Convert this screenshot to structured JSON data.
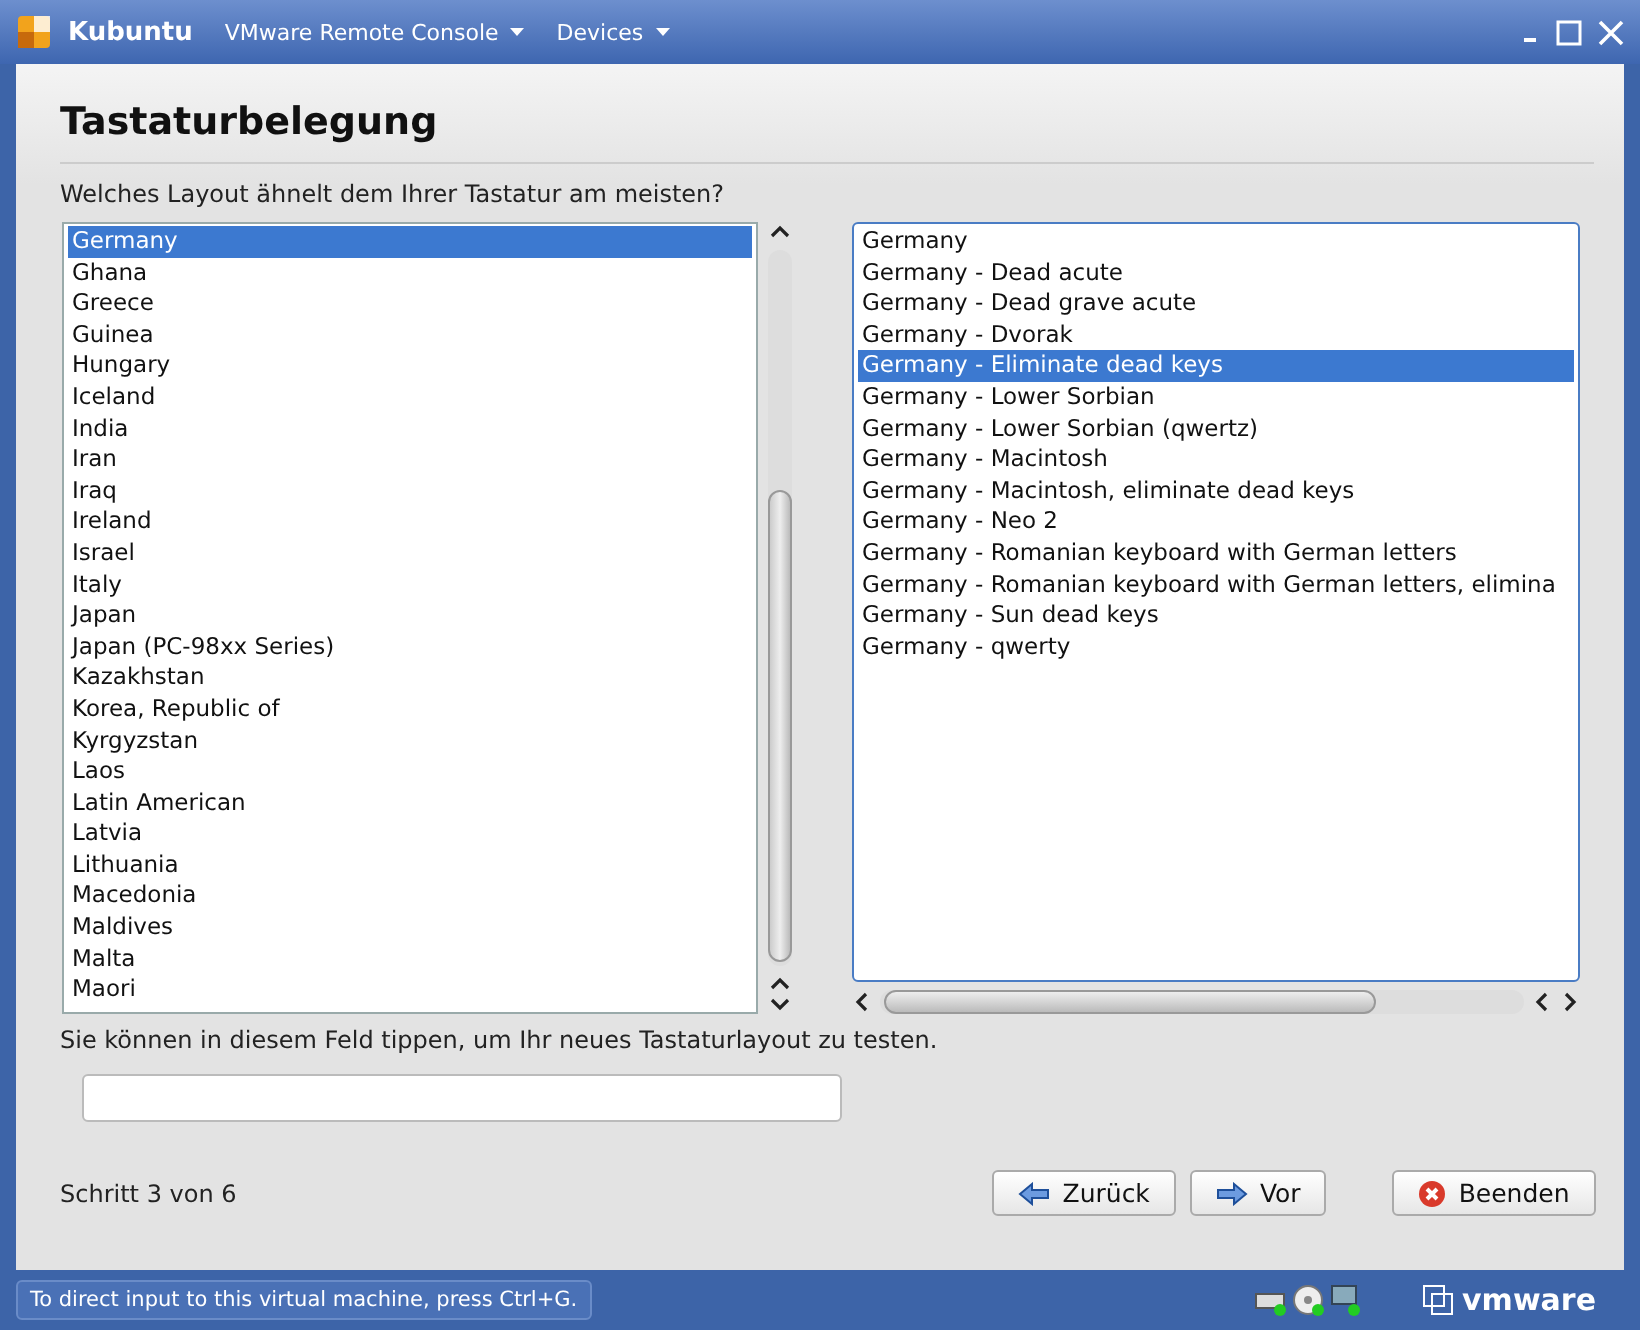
{
  "window": {
    "title": "Kubuntu",
    "menus": [
      {
        "label": "VMware Remote Console"
      },
      {
        "label": "Devices"
      }
    ]
  },
  "page": {
    "heading": "Tastaturbelegung",
    "question": "Welches Layout ähnelt dem Ihrer Tastatur am meisten?"
  },
  "layouts": [
    {
      "label": "Germany",
      "selected": true
    },
    {
      "label": "Ghana",
      "selected": false
    },
    {
      "label": "Greece",
      "selected": false
    },
    {
      "label": "Guinea",
      "selected": false
    },
    {
      "label": "Hungary",
      "selected": false
    },
    {
      "label": "Iceland",
      "selected": false
    },
    {
      "label": "India",
      "selected": false
    },
    {
      "label": "Iran",
      "selected": false
    },
    {
      "label": "Iraq",
      "selected": false
    },
    {
      "label": "Ireland",
      "selected": false
    },
    {
      "label": "Israel",
      "selected": false
    },
    {
      "label": "Italy",
      "selected": false
    },
    {
      "label": "Japan",
      "selected": false
    },
    {
      "label": "Japan (PC-98xx Series)",
      "selected": false
    },
    {
      "label": "Kazakhstan",
      "selected": false
    },
    {
      "label": "Korea, Republic of",
      "selected": false
    },
    {
      "label": "Kyrgyzstan",
      "selected": false
    },
    {
      "label": "Laos",
      "selected": false
    },
    {
      "label": "Latin American",
      "selected": false
    },
    {
      "label": "Latvia",
      "selected": false
    },
    {
      "label": "Lithuania",
      "selected": false
    },
    {
      "label": "Macedonia",
      "selected": false
    },
    {
      "label": "Maldives",
      "selected": false
    },
    {
      "label": "Malta",
      "selected": false
    },
    {
      "label": "Maori",
      "selected": false
    }
  ],
  "variants": [
    {
      "label": "Germany",
      "selected": false
    },
    {
      "label": "Germany - Dead acute",
      "selected": false
    },
    {
      "label": "Germany - Dead grave acute",
      "selected": false
    },
    {
      "label": "Germany - Dvorak",
      "selected": false
    },
    {
      "label": "Germany - Eliminate dead keys",
      "selected": true
    },
    {
      "label": "Germany - Lower Sorbian",
      "selected": false
    },
    {
      "label": "Germany - Lower Sorbian (qwertz)",
      "selected": false
    },
    {
      "label": "Germany - Macintosh",
      "selected": false
    },
    {
      "label": "Germany - Macintosh, eliminate dead keys",
      "selected": false
    },
    {
      "label": "Germany - Neo 2",
      "selected": false
    },
    {
      "label": "Germany - Romanian keyboard with German letters",
      "selected": false
    },
    {
      "label": "Germany - Romanian keyboard with German letters, elimina",
      "selected": false
    },
    {
      "label": "Germany - Sun dead keys",
      "selected": false
    },
    {
      "label": "Germany - qwerty",
      "selected": false
    }
  ],
  "test": {
    "hint": "Sie können in diesem Feld tippen, um Ihr neues Tastaturlayout zu testen."
  },
  "footer": {
    "step": "Schritt 3 von 6",
    "buttons": [
      {
        "label": "Zurück",
        "kind": "back"
      },
      {
        "label": "Vor",
        "kind": "next"
      },
      {
        "label": "Beenden",
        "kind": "quit"
      }
    ]
  },
  "status_bar": {
    "message": "To direct input to this virtual machine, press Ctrl+G.",
    "logo": "vmware"
  }
}
